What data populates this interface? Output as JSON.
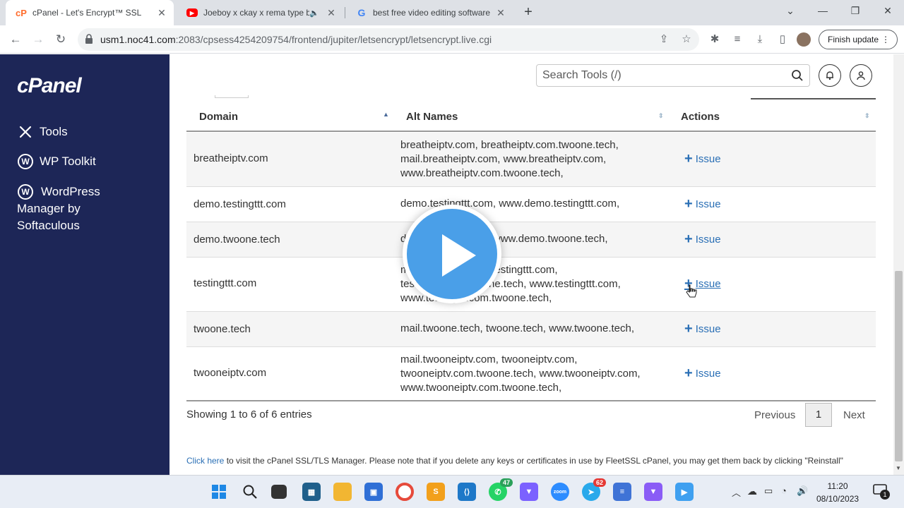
{
  "browser": {
    "tabs": [
      {
        "title": "cPanel - Let's Encrypt™ SSL",
        "icon": "cpanel-icon",
        "active": true
      },
      {
        "title": "Joeboy x ckay x rema type b",
        "icon": "youtube-icon",
        "active": false
      },
      {
        "title": "best free video editing software",
        "icon": "google-icon",
        "active": false
      }
    ],
    "url_host": "usm1.noc41.com",
    "url_path": ":2083/cpsess4254209754/frontend/jupiter/letsencrypt/letsencrypt.live.cgi",
    "finish_update": "Finish update"
  },
  "sidebar": {
    "logo": "cPanel",
    "items": [
      {
        "label": "Tools",
        "icon": "tools-icon"
      },
      {
        "label": "WP Toolkit",
        "icon": "wordpress-icon"
      },
      {
        "label": "WordPress Manager by Softaculous",
        "icon": "wordpress-icon"
      }
    ]
  },
  "header": {
    "search_placeholder": "Search Tools (/)"
  },
  "table": {
    "columns": [
      "Domain",
      "Alt Names",
      "Actions"
    ],
    "rows": [
      {
        "domain": "breatheiptv.com",
        "alt": [
          "breatheiptv.com, breatheiptv.com.twoone.tech,",
          "mail.breatheiptv.com, www.breatheiptv.com,",
          "www.breatheiptv.com.twoone.tech,"
        ],
        "action": "Issue"
      },
      {
        "domain": "demo.testingttt.com",
        "alt": [
          "demo.testingttt.com, www.demo.testingttt.com,"
        ],
        "action": "Issue"
      },
      {
        "domain": "demo.twoone.tech",
        "alt": [
          "demo.twoone.tech, www.demo.twoone.tech,"
        ],
        "action": "Issue"
      },
      {
        "domain": "testingttt.com",
        "alt": [
          "mail.testingttt.com, testingttt.com,",
          "testingttt.com.twoone.tech, www.testingttt.com,",
          "www.testingttt.com.twoone.tech,"
        ],
        "action": "Issue"
      },
      {
        "domain": "twoone.tech",
        "alt": [
          "mail.twoone.tech, twoone.tech, www.twoone.tech,"
        ],
        "action": "Issue"
      },
      {
        "domain": "twooneiptv.com",
        "alt": [
          "mail.twooneiptv.com, twooneiptv.com,",
          "twooneiptv.com.twoone.tech, www.twooneiptv.com,",
          "www.twooneiptv.com.twoone.tech,"
        ],
        "action": "Issue"
      }
    ]
  },
  "pagination": {
    "info": "Showing 1 to 6 of 6 entries",
    "previous": "Previous",
    "page": "1",
    "next": "Next"
  },
  "note": {
    "link": "Click here",
    "text": " to visit the cPanel SSL/TLS Manager. Please note that if you delete any keys or certificates in use by FleetSSL cPanel, you may get them back by clicking \"Reinstall\""
  },
  "taskbar": {
    "whatsapp_badge": "47",
    "telegram_badge": "62",
    "time": "11:20",
    "date": "08/10/2023",
    "notification_count": "1"
  },
  "colors": {
    "sidebar": "#1d2657",
    "link": "#2a6fb5",
    "play": "#4a9fe8"
  }
}
